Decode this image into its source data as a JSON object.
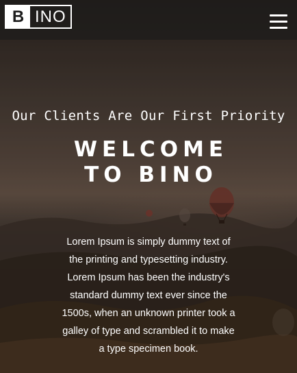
{
  "header": {
    "logo_letter": "B",
    "logo_rest": "INO"
  },
  "hero": {
    "tagline": "Our Clients Are Our First Priority",
    "headline_line1": "WELCOME",
    "headline_line2": "TO BINO",
    "body": "Lorem Ipsum is simply dummy text of the printing and typesetting industry. Lorem Ipsum has been the industry's standard dummy text ever since the 1500s, when an unknown printer took a galley of type and scrambled it to make a type specimen book."
  },
  "icons": {
    "menu": "hamburger-menu-icon"
  },
  "colors": {
    "header_bg": "#1e1c1b",
    "text": "#ffffff"
  }
}
